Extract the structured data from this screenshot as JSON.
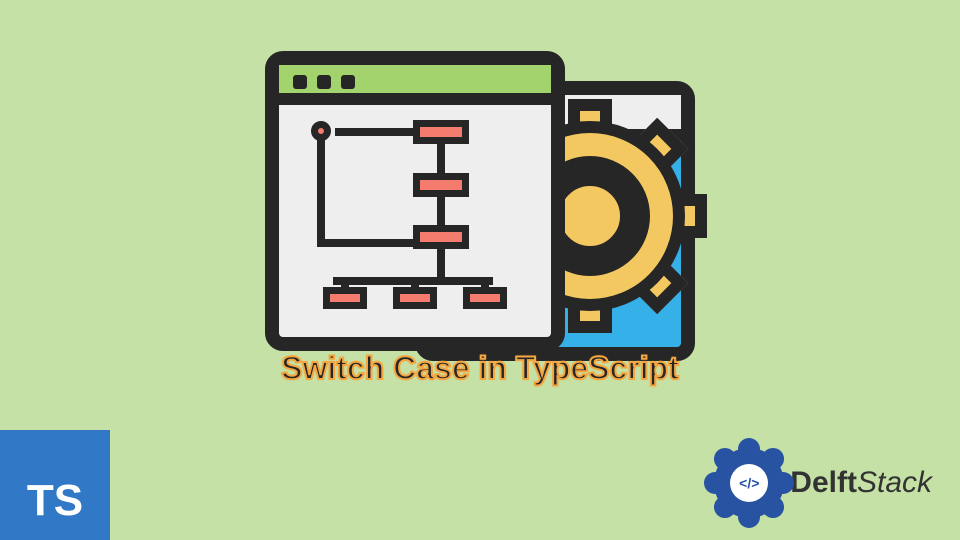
{
  "title": "Switch Case in TypeScript",
  "ts_logo": "TS",
  "brand": {
    "badge_text": "</>",
    "name_bold": "Delft",
    "name_rest": "Stack"
  },
  "colors": {
    "background": "#c5e1a5",
    "ts_blue": "#3178c6",
    "brand_blue": "#2853a3",
    "accent_orange": "#f4a640",
    "node_coral": "#f47c6e",
    "window_green": "#a3d36c",
    "window_cyan": "#35b0e8",
    "gear_yellow": "#f4c860"
  }
}
